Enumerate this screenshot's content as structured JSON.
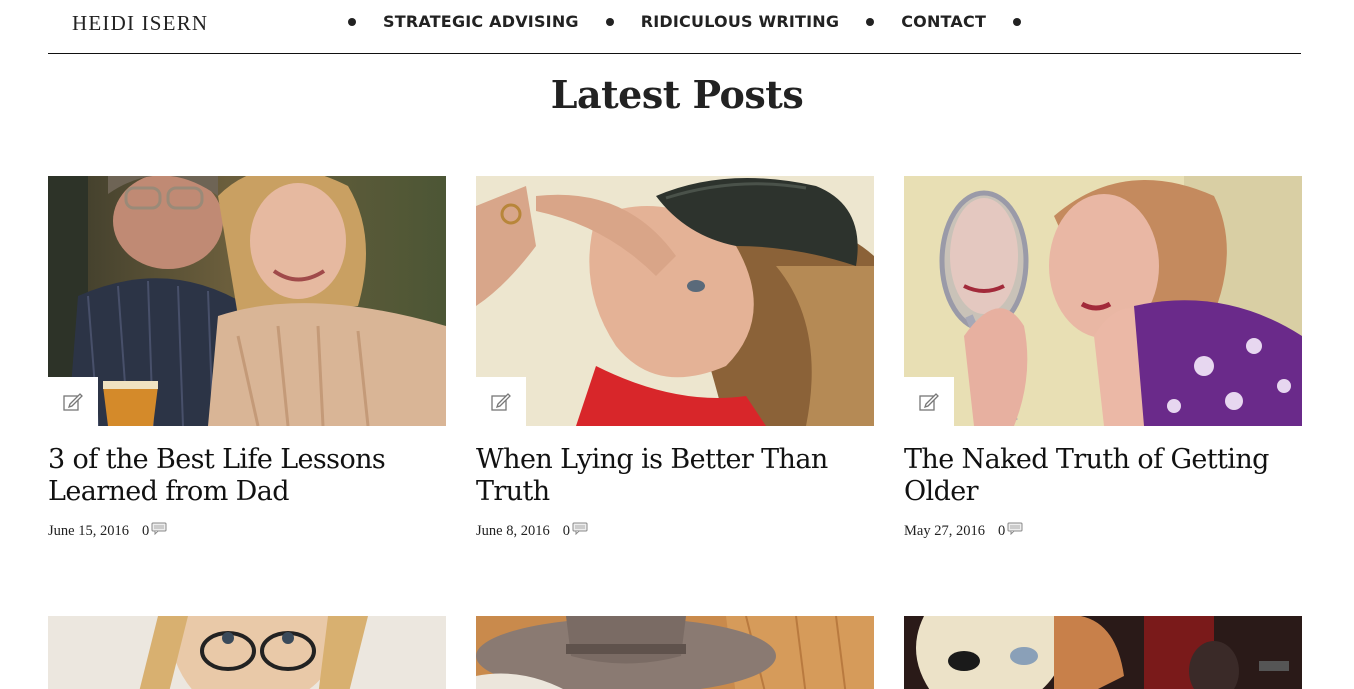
{
  "header": {
    "logo": "HEIDI ISERN",
    "nav": [
      {
        "label": "STRATEGIC ADVISING"
      },
      {
        "label": "RIDICULOUS WRITING"
      },
      {
        "label": "CONTACT"
      }
    ]
  },
  "section": {
    "title": "Latest Posts"
  },
  "posts": [
    {
      "title": "3 of the Best Life Lessons Learned from Dad",
      "date": "June 15, 2016",
      "comments": "0",
      "format_icon": "edit-icon",
      "comment_icon": "comment-bubble-icon"
    },
    {
      "title": "When Lying is Better Than Truth",
      "date": "June 8, 2016",
      "comments": "0",
      "format_icon": "edit-icon",
      "comment_icon": "comment-bubble-icon"
    },
    {
      "title": "The Naked Truth of Getting Older",
      "date": "May 27, 2016",
      "comments": "0",
      "format_icon": "edit-icon",
      "comment_icon": "comment-bubble-icon"
    }
  ],
  "colors": {
    "text": "#111111",
    "rule": "#111111",
    "background": "#ffffff"
  }
}
